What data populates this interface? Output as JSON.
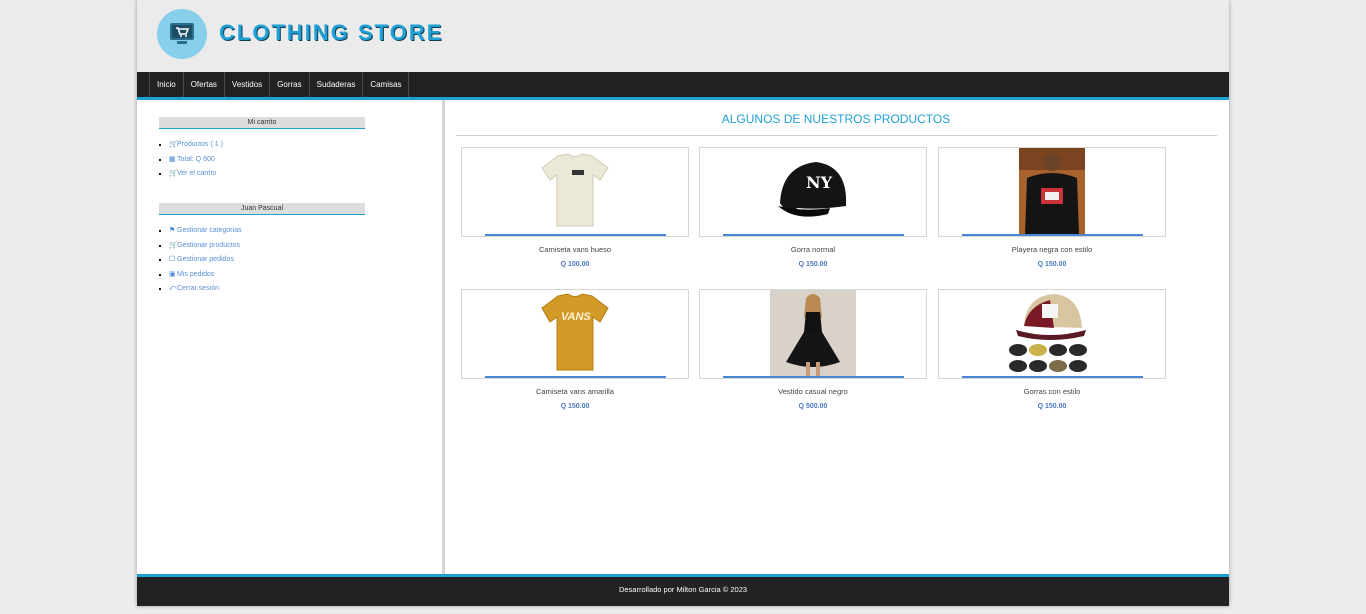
{
  "brand": {
    "title": "CLOTHING STORE",
    "logo_icon": "cart-icon"
  },
  "nav": {
    "items": [
      "Inicio",
      "Ofertas",
      "Vestidos",
      "Gorras",
      "Sudaderas",
      "Camisas"
    ]
  },
  "cart": {
    "title": "Mi carrito",
    "items": [
      {
        "icon": "cart-icon",
        "label": "Productos ( 1 )"
      },
      {
        "icon": "money-icon",
        "label": "Total: Q 600"
      },
      {
        "icon": "cart-icon",
        "label": "Ver el carrito"
      }
    ]
  },
  "user": {
    "title": "Juan Pascual",
    "items": [
      {
        "icon": "tag-icon",
        "label": "Gestionar categorias"
      },
      {
        "icon": "cart-icon",
        "label": "Gestionar productos"
      },
      {
        "icon": "clipboard-icon",
        "label": "Gestionar pedidos"
      },
      {
        "icon": "receipt-icon",
        "label": "Mis pedidos"
      },
      {
        "icon": "logout-icon",
        "label": "Cerrar sesión"
      }
    ]
  },
  "main": {
    "title": "ALGUNOS DE NUESTROS PRODUCTOS",
    "products": [
      {
        "name": "Camiseta vans hueso",
        "price": "Q 100.00",
        "image": "beige-tshirt"
      },
      {
        "name": "Gorra normal",
        "price": "Q 150.00",
        "image": "black-cap"
      },
      {
        "name": "Playera negra con estilo",
        "price": "Q 150.00",
        "image": "man-black-shirt"
      },
      {
        "name": "Camiseta vans amarilla",
        "price": "Q 150.00",
        "image": "yellow-tshirt"
      },
      {
        "name": "Vestido casual negro",
        "price": "Q 500.00",
        "image": "black-dress"
      },
      {
        "name": "Gorras con estilo",
        "price": "Q 150.00",
        "image": "trucker-caps"
      }
    ]
  },
  "footer": {
    "text": "Desarrollado por Milton Garcia © 2023"
  },
  "colors": {
    "accent": "#1ea0d6",
    "dark": "#222222",
    "link": "#5b8fd6"
  }
}
